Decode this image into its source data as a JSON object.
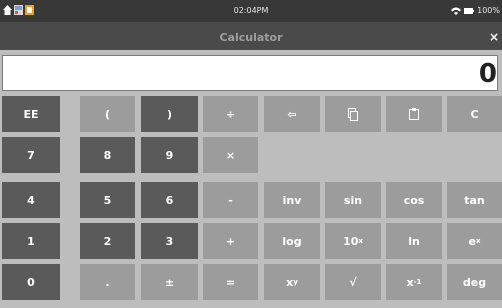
{
  "status": {
    "time": "02:04PM",
    "battery": "100%"
  },
  "title": "Calculator",
  "close_label": "×",
  "display": {
    "value": "0"
  },
  "buttons": {
    "ee": "EE",
    "open_paren": "(",
    "close_paren": ")",
    "divide": "÷",
    "backspace": "⇦",
    "copy": "▯",
    "paste": "▯",
    "clear": "C",
    "seven": "7",
    "eight": "8",
    "nine": "9",
    "multiply": "×",
    "four": "4",
    "five": "5",
    "six": "6",
    "minus": "-",
    "inv": "inv",
    "sin": "sin",
    "cos": "cos",
    "tan": "tan",
    "one": "1",
    "two": "2",
    "three": "3",
    "plus": "+",
    "log": "log",
    "ln": "ln",
    "zero": "0",
    "dot": ".",
    "plusminus": "±",
    "equals": "=",
    "sqrt": "√",
    "deg": "deg",
    "ten_pow": {
      "base": "10",
      "exp": "x"
    },
    "e_pow": {
      "base": "e",
      "exp": "x"
    },
    "x_pow_y": {
      "base": "x",
      "exp": "y"
    },
    "x_inverse": {
      "base": "x",
      "exp": "-1"
    }
  }
}
